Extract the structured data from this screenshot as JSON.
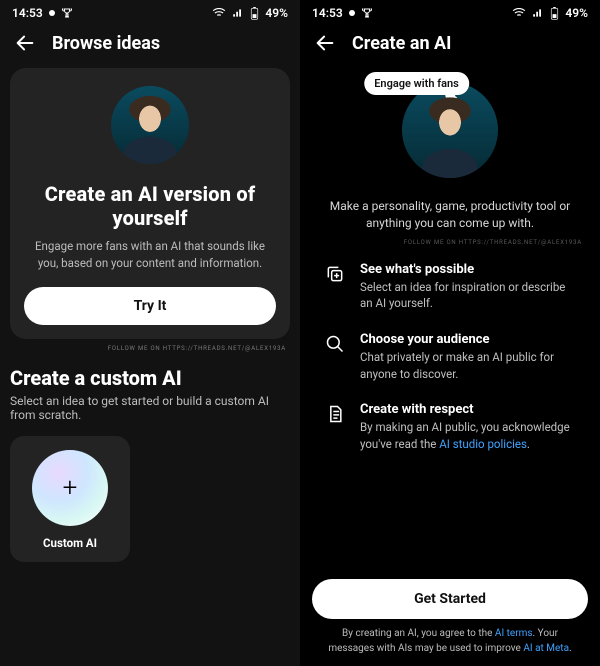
{
  "status": {
    "time": "14:53",
    "battery": "49%"
  },
  "left": {
    "title": "Browse ideas",
    "card": {
      "headline": "Create an AI version of yourself",
      "sub": "Engage more fans with an AI that sounds like you, based on your content and information.",
      "cta": "Try It"
    },
    "watermark": "FOLLOW ME ON HTTPS://THREADS.NET/@ALEX193A",
    "custom": {
      "title": "Create a custom AI",
      "sub": "Select an idea to get started or build a custom AI from scratch.",
      "tile_label": "Custom AI"
    }
  },
  "right": {
    "title": "Create an AI",
    "bubble": "Engage with fans",
    "hero_sub": "Make a personality, game, productivity tool or anything you can come up with.",
    "watermark": "FOLLOW ME ON HTTPS://THREADS.NET/@ALEX193A",
    "items": [
      {
        "title": "See what's possible",
        "sub": "Select an idea for inspiration or describe an AI yourself."
      },
      {
        "title": "Choose your audience",
        "sub": "Chat privately or make an AI public for anyone to discover."
      },
      {
        "title": "Create with respect",
        "sub_prefix": "By making an AI public, you acknowledge you've read the ",
        "link": "AI studio policies",
        "sub_suffix": "."
      }
    ],
    "cta": "Get Started",
    "legal_1": "By creating an AI, you agree to the ",
    "legal_link1": "AI terms",
    "legal_2": ". Your messages with AIs may be used to improve ",
    "legal_link2": "AI at Meta",
    "legal_3": "."
  }
}
